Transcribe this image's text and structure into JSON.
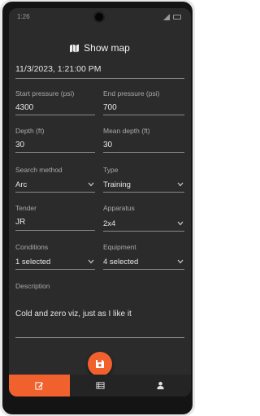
{
  "status_bar": {
    "time": "1:26"
  },
  "header": {
    "show_map_label": "Show map"
  },
  "form": {
    "datetime": "11/3/2023, 1:21:00 PM",
    "start_pressure": {
      "label": "Start pressure (psi)",
      "value": "4300"
    },
    "end_pressure": {
      "label": "End pressure (psi)",
      "value": "700"
    },
    "depth": {
      "label": "Depth (ft)",
      "value": "30"
    },
    "mean_depth": {
      "label": "Mean depth (ft)",
      "value": "30"
    },
    "search_method": {
      "label": "Search method",
      "value": "Arc"
    },
    "type": {
      "label": "Type",
      "value": "Training"
    },
    "tender": {
      "label": "Tender",
      "value": "JR"
    },
    "apparatus": {
      "label": "Apparatus",
      "value": "2x4"
    },
    "conditions": {
      "label": "Conditions",
      "value": "1 selected"
    },
    "equipment": {
      "label": "Equipment",
      "value": "4 selected"
    },
    "description": {
      "label": "Description",
      "value": "Cold and zero viz, just as I like it"
    }
  },
  "fab": {
    "icon": "save-icon"
  },
  "bottom_nav": {
    "tabs": [
      {
        "icon": "edit-icon",
        "active": true
      },
      {
        "icon": "list-icon",
        "active": false
      },
      {
        "icon": "person-icon",
        "active": false
      }
    ]
  },
  "colors": {
    "accent": "#f0612e",
    "background": "#2b2b2b"
  }
}
